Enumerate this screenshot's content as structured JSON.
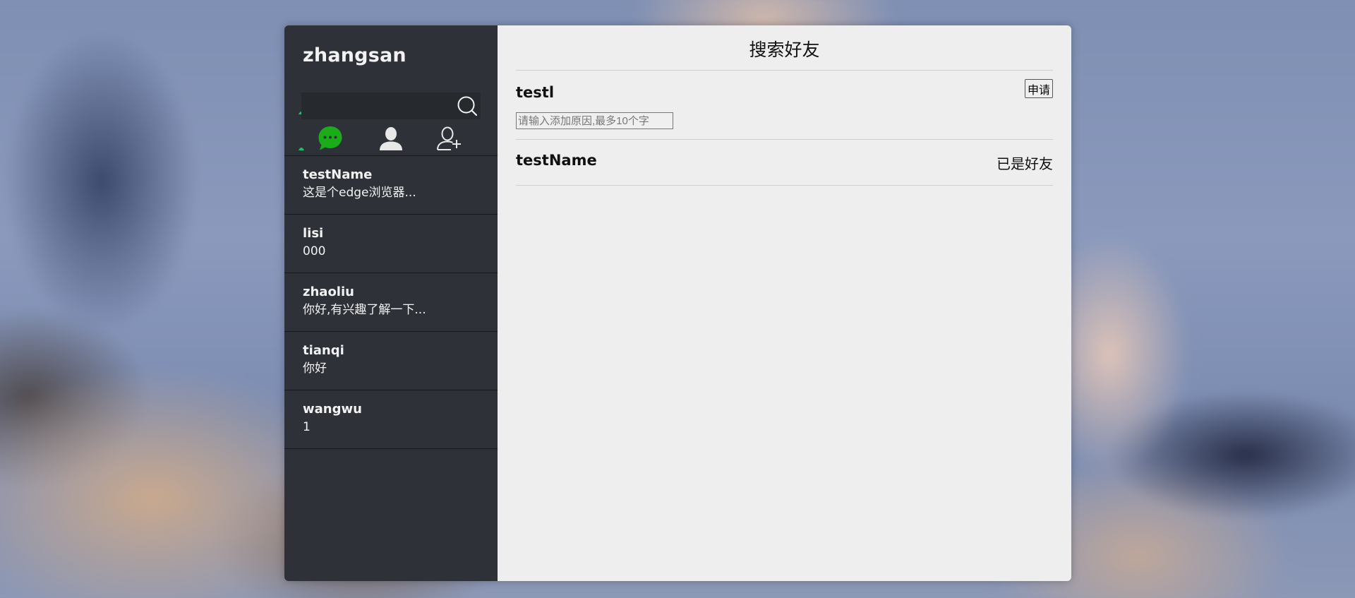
{
  "sidebar": {
    "username": "zhangsan",
    "search": {
      "value": "",
      "placeholder": ""
    },
    "nav": [
      {
        "icon": "chat-icon",
        "active": true
      },
      {
        "icon": "contacts-icon",
        "active": false
      },
      {
        "icon": "add-friend-icon",
        "active": false
      }
    ],
    "chats": [
      {
        "name": "testName",
        "message": "这是个edge浏览器..."
      },
      {
        "name": "lisi",
        "message": "000"
      },
      {
        "name": "zhaoliu",
        "message": "你好,有兴趣了解一下..."
      },
      {
        "name": "tianqi",
        "message": "你好"
      },
      {
        "name": "wangwu",
        "message": "1"
      }
    ]
  },
  "main": {
    "title": "搜索好友",
    "results": [
      {
        "name": "testl",
        "apply_label": "申请",
        "reason_placeholder": "请输入添加原因,最多10个字",
        "reason_value": ""
      },
      {
        "name": "testName",
        "status": "已是好友"
      }
    ]
  },
  "colors": {
    "sidebar_bg": "#2e3238",
    "main_bg": "#eeeeee",
    "accent_green": "#1aad19"
  }
}
